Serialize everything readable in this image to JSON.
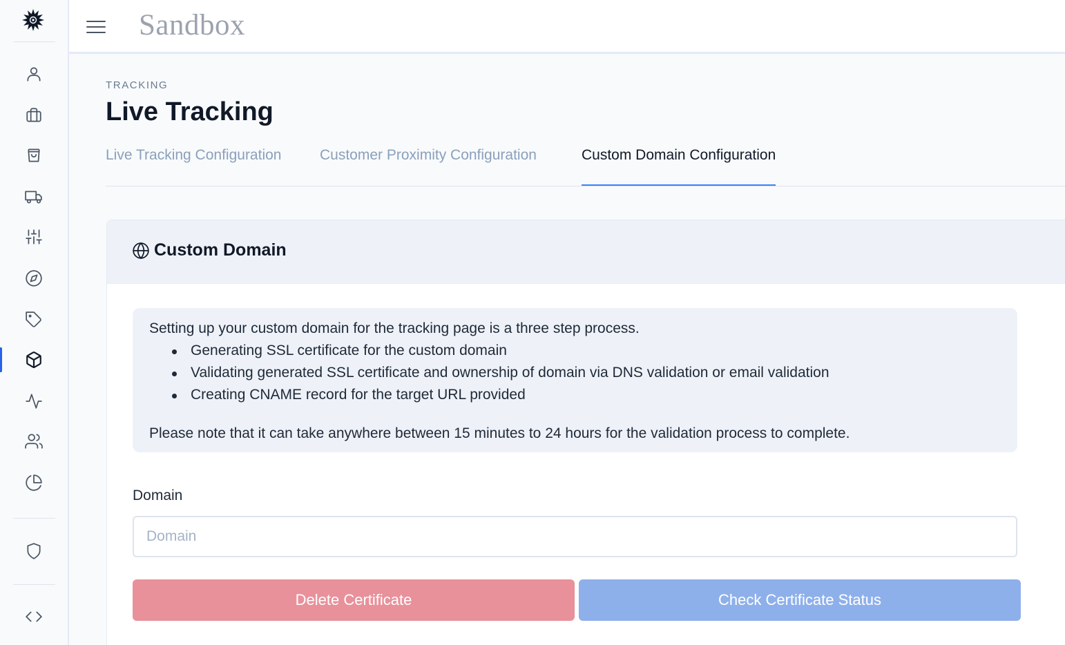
{
  "app": {
    "brand": "Sandbox"
  },
  "sidebar": {
    "items": [
      {
        "icon": "user-icon"
      },
      {
        "icon": "briefcase-icon"
      },
      {
        "icon": "shopping-bag-icon"
      },
      {
        "icon": "truck-icon"
      },
      {
        "icon": "sliders-icon"
      },
      {
        "icon": "compass-icon"
      },
      {
        "icon": "tag-icon"
      },
      {
        "icon": "package-icon",
        "active": true
      },
      {
        "icon": "activity-icon"
      },
      {
        "icon": "users-icon"
      },
      {
        "icon": "pie-chart-icon"
      },
      {
        "icon": "shield-icon"
      },
      {
        "icon": "code-icon"
      }
    ]
  },
  "header": {
    "breadcrumb": "TRACKING",
    "title": "Live Tracking"
  },
  "tabs": [
    {
      "label": "Live Tracking Configuration",
      "active": false
    },
    {
      "label": "Customer Proximity Configuration",
      "active": false
    },
    {
      "label": "Custom Domain Configuration",
      "active": true
    }
  ],
  "card": {
    "title": "Custom Domain",
    "icon": "globe-icon",
    "info": {
      "intro": "Setting up your custom domain for the tracking page is a three step process.",
      "steps": [
        "Generating SSL certificate for the custom domain",
        "Validating generated SSL certificate and ownership of domain via DNS validation or email validation",
        "Creating CNAME record for the target URL provided"
      ],
      "note": "Please note that it can take anywhere between 15 minutes to 24 hours for the validation process to complete."
    },
    "domain_field": {
      "label": "Domain",
      "placeholder": "Domain",
      "value": ""
    },
    "buttons": {
      "delete_label": "Delete Certificate",
      "check_label": "Check Certificate Status"
    }
  },
  "colors": {
    "accent": "#3b82f6",
    "delete_button": "#e8919b",
    "check_button": "#8eb0ea"
  }
}
